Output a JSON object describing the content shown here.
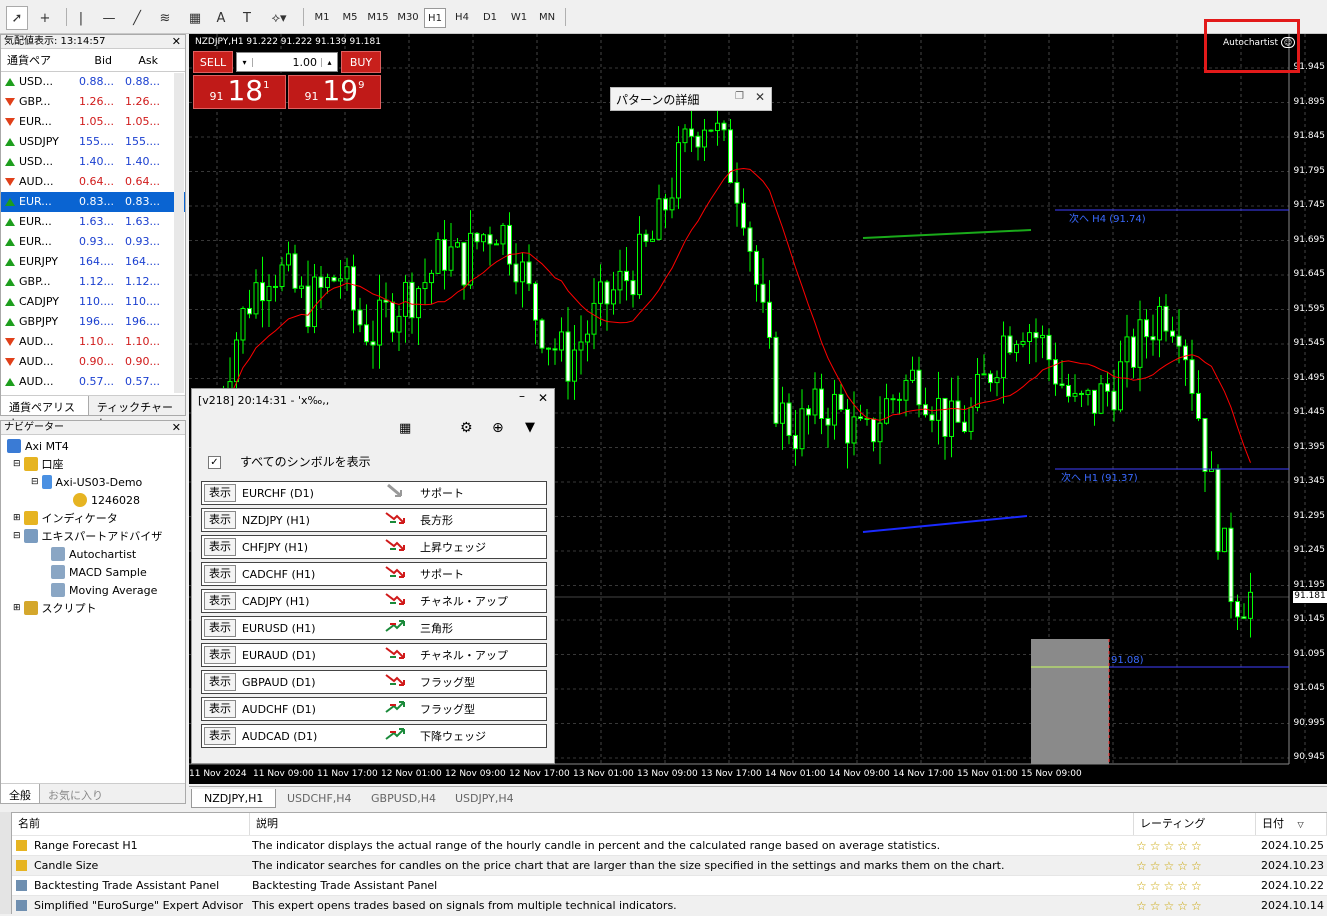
{
  "toolbar": {
    "timeframes": [
      "M1",
      "M5",
      "M15",
      "M30",
      "H1",
      "H4",
      "D1",
      "W1",
      "MN"
    ],
    "active_timeframe": "H1"
  },
  "market_watch": {
    "title": "気配値表示: 13:14:57",
    "columns": [
      "通貨ペア",
      "Bid",
      "Ask"
    ],
    "rows": [
      {
        "symbol": "USD...",
        "bid": "0.88...",
        "ask": "0.88...",
        "dir": "up",
        "bid_color": "#1a3fd0"
      },
      {
        "symbol": "GBP...",
        "bid": "1.26...",
        "ask": "1.26...",
        "dir": "down",
        "bid_color": "#d01a1a"
      },
      {
        "symbol": "EUR...",
        "bid": "1.05...",
        "ask": "1.05...",
        "dir": "down",
        "bid_color": "#d01a1a"
      },
      {
        "symbol": "USDJPY",
        "bid": "155....",
        "ask": "155....",
        "dir": "up",
        "bid_color": "#1a3fd0"
      },
      {
        "symbol": "USD...",
        "bid": "1.40...",
        "ask": "1.40...",
        "dir": "up",
        "bid_color": "#1a3fd0"
      },
      {
        "symbol": "AUD...",
        "bid": "0.64...",
        "ask": "0.64...",
        "dir": "down",
        "bid_color": "#d01a1a"
      },
      {
        "symbol": "EUR...",
        "bid": "0.83...",
        "ask": "0.83...",
        "dir": "up",
        "bid_color": "#1a3fd0",
        "selected": true
      },
      {
        "symbol": "EUR...",
        "bid": "1.63...",
        "ask": "1.63...",
        "dir": "up",
        "bid_color": "#1a3fd0"
      },
      {
        "symbol": "EUR...",
        "bid": "0.93...",
        "ask": "0.93...",
        "dir": "up",
        "bid_color": "#1a3fd0"
      },
      {
        "symbol": "EURJPY",
        "bid": "164....",
        "ask": "164....",
        "dir": "up",
        "bid_color": "#1a3fd0"
      },
      {
        "symbol": "GBP...",
        "bid": "1.12...",
        "ask": "1.12...",
        "dir": "up",
        "bid_color": "#1a3fd0"
      },
      {
        "symbol": "CADJPY",
        "bid": "110....",
        "ask": "110....",
        "dir": "up",
        "bid_color": "#1a3fd0"
      },
      {
        "symbol": "GBPJPY",
        "bid": "196....",
        "ask": "196....",
        "dir": "up",
        "bid_color": "#1a3fd0"
      },
      {
        "symbol": "AUD...",
        "bid": "1.10...",
        "ask": "1.10...",
        "dir": "down",
        "bid_color": "#d01a1a"
      },
      {
        "symbol": "AUD...",
        "bid": "0.90...",
        "ask": "0.90...",
        "dir": "down",
        "bid_color": "#d01a1a"
      },
      {
        "symbol": "AUD...",
        "bid": "0.57...",
        "ask": "0.57...",
        "dir": "up",
        "bid_color": "#1a3fd0"
      }
    ],
    "tabs": [
      "通貨ペアリスト",
      "ティックチャート"
    ]
  },
  "navigator": {
    "title": "ナビゲーター",
    "root": "Axi MT4",
    "accounts_label": "口座",
    "account_server": "Axi-US03-Demo",
    "account_number": "1246028",
    "indicators_label": "インディケータ",
    "experts_label": "エキスパートアドバイザ",
    "experts": [
      "Autochartist",
      "MACD Sample",
      "Moving Average"
    ],
    "scripts_label": "スクリプト",
    "tabs": [
      "全般",
      "お気に入り"
    ]
  },
  "chart": {
    "header": "NZDJPY,H1  91.222 91.222 91.139 91.181",
    "autochartist_label": "Autochartist",
    "price_labels": [
      "91.945",
      "91.895",
      "91.845",
      "91.795",
      "91.745",
      "91.695",
      "91.645",
      "91.595",
      "91.545",
      "91.495",
      "91.445",
      "91.395",
      "91.345",
      "91.295",
      "91.245",
      "91.195",
      "91.145",
      "91.095",
      "91.045",
      "90.995",
      "90.945"
    ],
    "current_price": "91.181",
    "time_labels": [
      "11 Nov 2024",
      "11 Nov 09:00",
      "11 Nov 17:00",
      "12 Nov 01:00",
      "12 Nov 09:00",
      "12 Nov 17:00",
      "13 Nov 01:00",
      "13 Nov 09:00",
      "13 Nov 17:00",
      "14 Nov 01:00",
      "14 Nov 09:00",
      "14 Nov 17:00",
      "15 Nov 01:00",
      "15 Nov 09:00"
    ],
    "annotations": [
      "次へ H4 (91.74)",
      "次へ H1 (91.37)",
      "91.08)"
    ],
    "colors": {
      "candle": "#00ff00",
      "ma": "#ff0000",
      "resistance": "#1aaa1a",
      "support": "#1a2aff",
      "level": "#4040ff"
    }
  },
  "trade_panel": {
    "sell_label": "SELL",
    "buy_label": "BUY",
    "lot": "1.00",
    "sell_prefix": "91",
    "sell_big": "18",
    "sell_sup": "1",
    "buy_prefix": "91",
    "buy_big": "19",
    "buy_sup": "9"
  },
  "pattern_dialog": {
    "title": "パターンの詳細"
  },
  "scanner": {
    "title": "[v218] 20:14:31 - 'x‰,,",
    "show_all_label": "すべてのシンボルを表示",
    "show_label": "表示",
    "rows": [
      {
        "symbol": "EURCHF (D1)",
        "pattern": "サポート",
        "dir": "neutral"
      },
      {
        "symbol": "NZDJPY (H1)",
        "pattern": "長方形",
        "dir": "down"
      },
      {
        "symbol": "CHFJPY (H1)",
        "pattern": "上昇ウェッジ",
        "dir": "down"
      },
      {
        "symbol": "CADCHF (H1)",
        "pattern": "サポート",
        "dir": "down"
      },
      {
        "symbol": "CADJPY (H1)",
        "pattern": "チャネル・アップ",
        "dir": "down"
      },
      {
        "symbol": "EURUSD (H1)",
        "pattern": "三角形",
        "dir": "up"
      },
      {
        "symbol": "EURAUD (D1)",
        "pattern": "チャネル・アップ",
        "dir": "down"
      },
      {
        "symbol": "GBPAUD (D1)",
        "pattern": "フラッグ型",
        "dir": "down"
      },
      {
        "symbol": "AUDCHF (D1)",
        "pattern": "フラッグ型",
        "dir": "up"
      },
      {
        "symbol": "AUDCAD (D1)",
        "pattern": "下降ウェッジ",
        "dir": "up"
      }
    ]
  },
  "chart_tabs": [
    "NZDJPY,H1",
    "USDCHF,H4",
    "GBPUSD,H4",
    "USDJPY,H4"
  ],
  "market_table": {
    "columns": [
      "名前",
      "説明",
      "レーティング",
      "日付"
    ],
    "rows": [
      {
        "name": "Range Forecast H1",
        "desc": "The indicator displays the actual range of the hourly candle in percent and the calculated range based on average statistics.",
        "date": "2024.10.25",
        "stars": "☆☆☆☆☆"
      },
      {
        "name": "Candle Size",
        "desc": "The indicator searches for candles on the price chart that are larger than the size specified in the settings and marks them on the chart.",
        "date": "2024.10.23",
        "stars": "☆☆☆☆☆"
      },
      {
        "name": "Backtesting Trade Assistant Panel",
        "desc": "Backtesting Trade Assistant Panel",
        "date": "2024.10.22",
        "stars": "☆☆☆☆☆"
      },
      {
        "name": "Simplified \"EuroSurge\" Expert Advisor",
        "desc": "This expert opens trades based on signals from multiple technical indicators.",
        "date": "2024.10.14",
        "stars": "☆☆☆☆☆"
      }
    ]
  }
}
